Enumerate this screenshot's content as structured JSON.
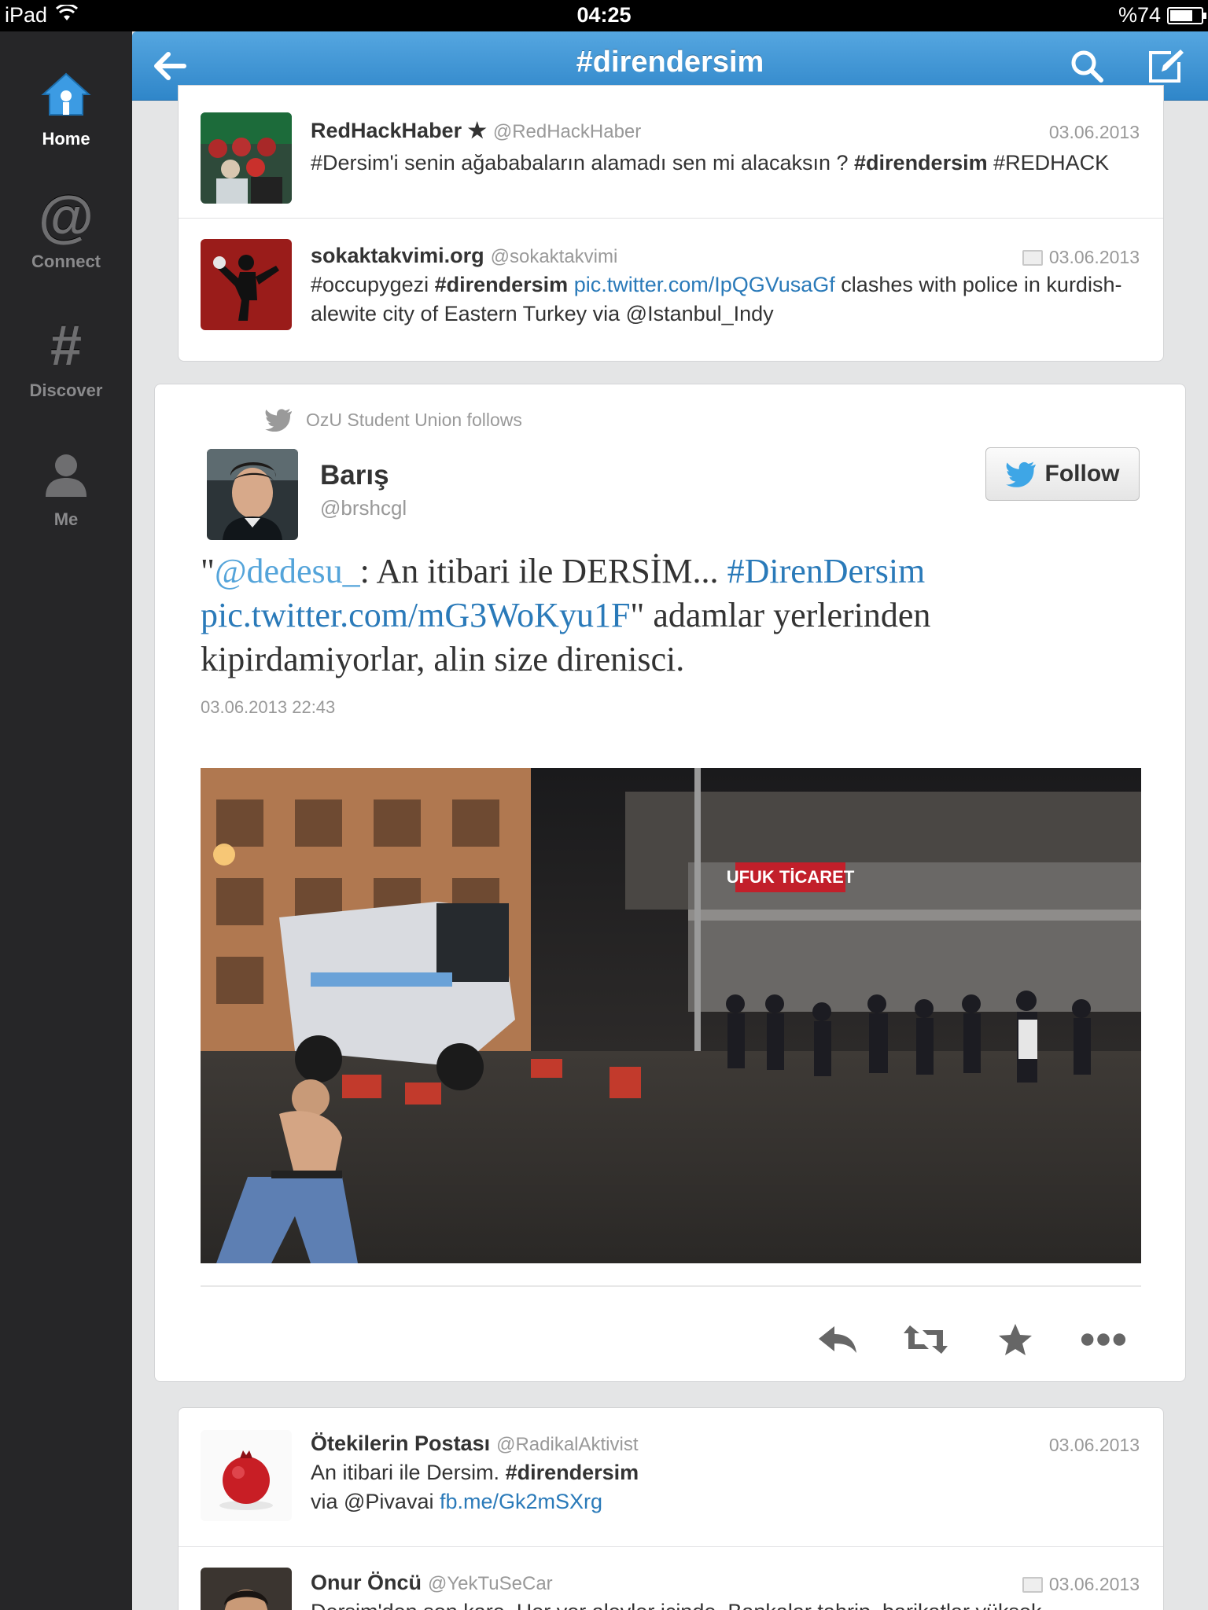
{
  "status_bar": {
    "device": "iPad",
    "time": "04:25",
    "battery": "%74",
    "battery_level": 0.74
  },
  "sidebar": {
    "items": [
      {
        "label": "Home",
        "icon": "home-icon",
        "active": true
      },
      {
        "label": "Connect",
        "icon": "at-icon",
        "glyph": "@"
      },
      {
        "label": "Discover",
        "icon": "hash-icon",
        "glyph": "#"
      },
      {
        "label": "Me",
        "icon": "person-icon"
      }
    ]
  },
  "header": {
    "title": "#direndersim",
    "back_icon": "back-arrow-icon",
    "search_icon": "search-icon",
    "compose_icon": "compose-icon"
  },
  "colors": {
    "accent": "#2f86c9",
    "link": "#2a7ab9",
    "sidebar_bg": "#262628"
  },
  "tweets_top": [
    {
      "name": "RedHackHaber",
      "star": "★",
      "handle": "@RedHackHaber",
      "date": "03.06.2013",
      "text_a": "#Dersim'i senin ağababaların alamadı sen mi alacaksın ? ",
      "text_bold": "#direndersim",
      "text_b": " #REDHACK"
    },
    {
      "name": "sokaktakvimi.org",
      "handle": "@sokaktakvimi",
      "date": "03.06.2013",
      "text_a": "#occupygezi ",
      "text_bold": "#direndersim",
      "text_link": " pic.twitter.com/IpQGVusaGf",
      "text_b": " clashes with police in kurdish-alewite city of Eastern Turkey via @Istanbul_Indy"
    }
  ],
  "expanded": {
    "follows_context": "OzU Student Union follows",
    "name": "Barış",
    "handle": "@brshcgl",
    "follow_label": "Follow",
    "text_q1": "\"",
    "text_mention": "@dedesu_",
    "text_mid": ": An itibari ile DERSİM... ",
    "text_hashtag": "#DirenDersim",
    "text_link": "pic.twitter.com/mG3WoKyu1F",
    "text_end": "\" adamlar yerlerinden kipirdamiyorlar, alin size direnisci.",
    "timestamp": "03.06.2013 22:43",
    "photo_sign": "UFUK TİCARET",
    "actions": [
      "reply-icon",
      "retweet-icon",
      "favorite-icon",
      "more-icon"
    ]
  },
  "tweets_bottom": [
    {
      "name": "Ötekilerin Postası",
      "handle": "@RadikalAktivist",
      "date": "03.06.2013",
      "text_a": "An itibari ile Dersim. ",
      "text_bold": "#direndersim",
      "text_b": "via @Pivavai ",
      "text_link": "fb.me/Gk2mSXrg"
    },
    {
      "name": "Onur Öncü",
      "handle": "@YekTuSeCar",
      "date": "03.06.2013",
      "text_a": "Dersim'den son kare. Her yer alevler içinde. Bankalar tahrip, barikatlar yüksek."
    }
  ]
}
